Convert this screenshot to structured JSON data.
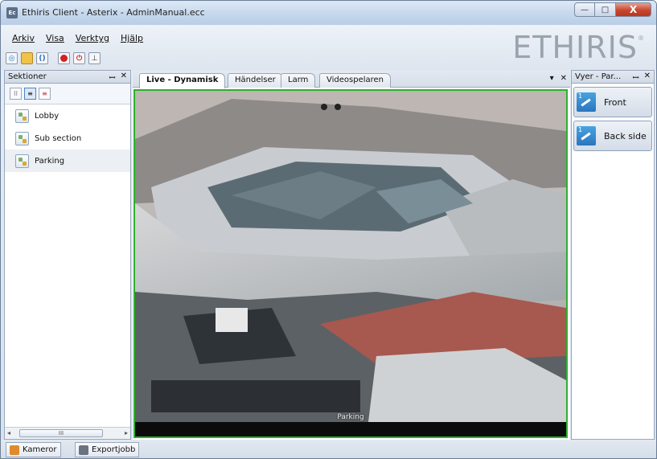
{
  "window": {
    "title": "Ethiris Client - Asterix - AdminManual.ecc",
    "app_icon": "Ec",
    "controls": {
      "minimize": "—",
      "maximize": "□",
      "close": "X"
    }
  },
  "menu": {
    "items": [
      {
        "label": "Arkiv"
      },
      {
        "label": "Visa"
      },
      {
        "label": "Verktyg"
      },
      {
        "label": "Hjälp"
      }
    ]
  },
  "toolbar": {
    "icons": [
      "settings-icon",
      "folder-icon",
      "bracket-icon",
      "record-icon",
      "power-icon",
      "download-icon"
    ]
  },
  "logo": {
    "text": "ETHIRIS",
    "mark": "®"
  },
  "sections_panel": {
    "title": "Sektioner",
    "pin": "ꟷ",
    "close": "✕",
    "items": [
      {
        "label": "Lobby"
      },
      {
        "label": "Sub section"
      },
      {
        "label": "Parking",
        "selected": true
      }
    ],
    "scroll": {
      "left": "◂",
      "thumb": "III",
      "right": "▸"
    }
  },
  "tabs": {
    "items": [
      {
        "label": "Live - Dynamisk",
        "active": true
      },
      {
        "label": "Händelser"
      },
      {
        "label": "Larm"
      },
      {
        "label": "Videospelaren"
      }
    ],
    "dropdown": "▾",
    "close": "✕"
  },
  "video": {
    "camera_label": "Parking",
    "border_color": "#2fb02f"
  },
  "views_panel": {
    "title": "Vyer - Par...",
    "pin": "ꟷ",
    "close": "✕",
    "views": [
      {
        "label": "Front"
      },
      {
        "label": "Back side"
      }
    ]
  },
  "bottom_tabs": [
    {
      "label": "Kameror",
      "icon": "camera-icon"
    },
    {
      "label": "Exportjobb",
      "icon": "export-icon"
    }
  ]
}
